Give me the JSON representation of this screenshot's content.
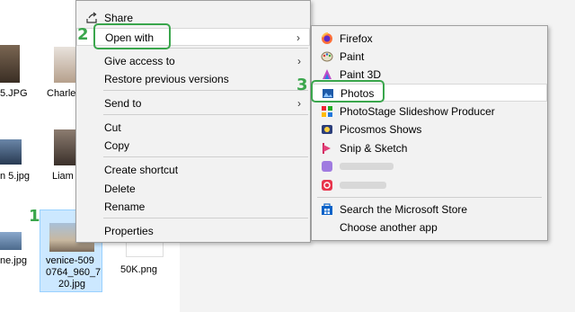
{
  "files": {
    "row1": [
      "5.JPG",
      "Charle"
    ],
    "row2": [
      "n 5.jpg",
      "Liam"
    ],
    "row3_left": "ne.jpg",
    "selected": [
      "venice-509",
      "0764_960_7",
      "20.jpg"
    ],
    "other": "50K.png"
  },
  "context_menu": {
    "items": [
      {
        "label": "Share",
        "icon": "share-icon"
      },
      {
        "label": "Open with",
        "arrow": "›"
      },
      {
        "label": "Give access to",
        "arrow": "›"
      },
      {
        "label": "Restore previous versions"
      },
      {
        "label": "Send to",
        "arrow": "›"
      },
      {
        "label": "Cut"
      },
      {
        "label": "Copy"
      },
      {
        "label": "Create shortcut"
      },
      {
        "label": "Delete"
      },
      {
        "label": "Rename"
      },
      {
        "label": "Properties"
      }
    ]
  },
  "open_with_menu": {
    "items": [
      {
        "label": "Firefox",
        "icon": "firefox-icon"
      },
      {
        "label": "Paint",
        "icon": "paint-icon"
      },
      {
        "label": "Paint 3D",
        "icon": "paint-3d-icon"
      },
      {
        "label": "Photos",
        "icon": "photos-icon"
      },
      {
        "label": "PhotoStage Slideshow Producer",
        "icon": "photostage-icon"
      },
      {
        "label": "Picosmos Shows",
        "icon": "picosmos-icon"
      },
      {
        "label": "Snip & Sketch",
        "icon": "snip-sketch-icon"
      },
      {
        "label": "Search the Microsoft Store",
        "icon": "store-icon"
      },
      {
        "label": "Choose another app"
      }
    ]
  },
  "callouts": {
    "step1": "1",
    "step2": "2",
    "step3": "3"
  },
  "colors": {
    "callout": "#3aa64c",
    "selection": "#cce8ff"
  }
}
